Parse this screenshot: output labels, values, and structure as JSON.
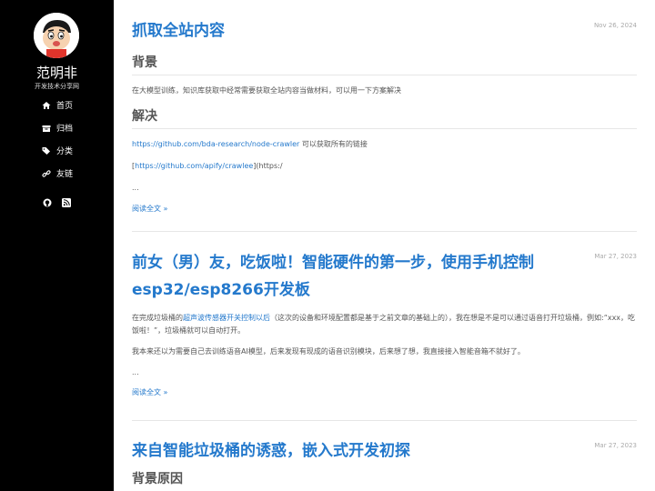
{
  "sidebar": {
    "site_name": "范明非",
    "site_desc": "开发技术分享网",
    "nav": [
      {
        "label": "首页",
        "icon": "home-icon"
      },
      {
        "label": "归档",
        "icon": "archive-icon"
      },
      {
        "label": "分类",
        "icon": "tags-icon"
      },
      {
        "label": "友链",
        "icon": "link-icon"
      }
    ],
    "social": [
      "github-icon",
      "rss-icon"
    ]
  },
  "posts": [
    {
      "title": "抓取全站内容",
      "date": "Nov 26, 2024",
      "section1": "背景",
      "intro": "在大模型训练，知识库获取中经常需要获取全站内容当做材料，可以用一下方案解决",
      "section2": "解决",
      "link1": "https://github.com/bda-research/node-crawler",
      "link1_after": " 可以获取所有的链接",
      "link2_prefix": "[",
      "link2": "https://github.com/apify/crawlee",
      "link2_after": "](https:/",
      "ellipsis": "...",
      "more": "阅读全文 »"
    },
    {
      "title_line1": "前女（男）友，吃饭啦！智能硬件的第一步，使用手机控制",
      "title_line2": "esp32/esp8266开发板",
      "date": "Mar 27, 2023",
      "p1_before": "在完成垃圾桶的",
      "p1_link": "超声波传感器开关控制以后",
      "p1_after": "（这次的设备和环境配置都是基于之前文章的基础上的），我在想是不是可以通过语音打开垃圾桶，例如:“xxx，吃饭啦！”，垃圾桶就可以自动打开。",
      "p2": "我本来还以为需要自己去训练语音AI模型，后来发现有现成的语音识别模块，后来想了想，我直接接入智能音箱不就好了。",
      "ellipsis": "...",
      "more": "阅读全文 »"
    },
    {
      "title": "来自智能垃圾桶的诱惑，嵌入式开发初探",
      "date": "Mar 27, 2023",
      "section1": "背景原因"
    }
  ]
}
